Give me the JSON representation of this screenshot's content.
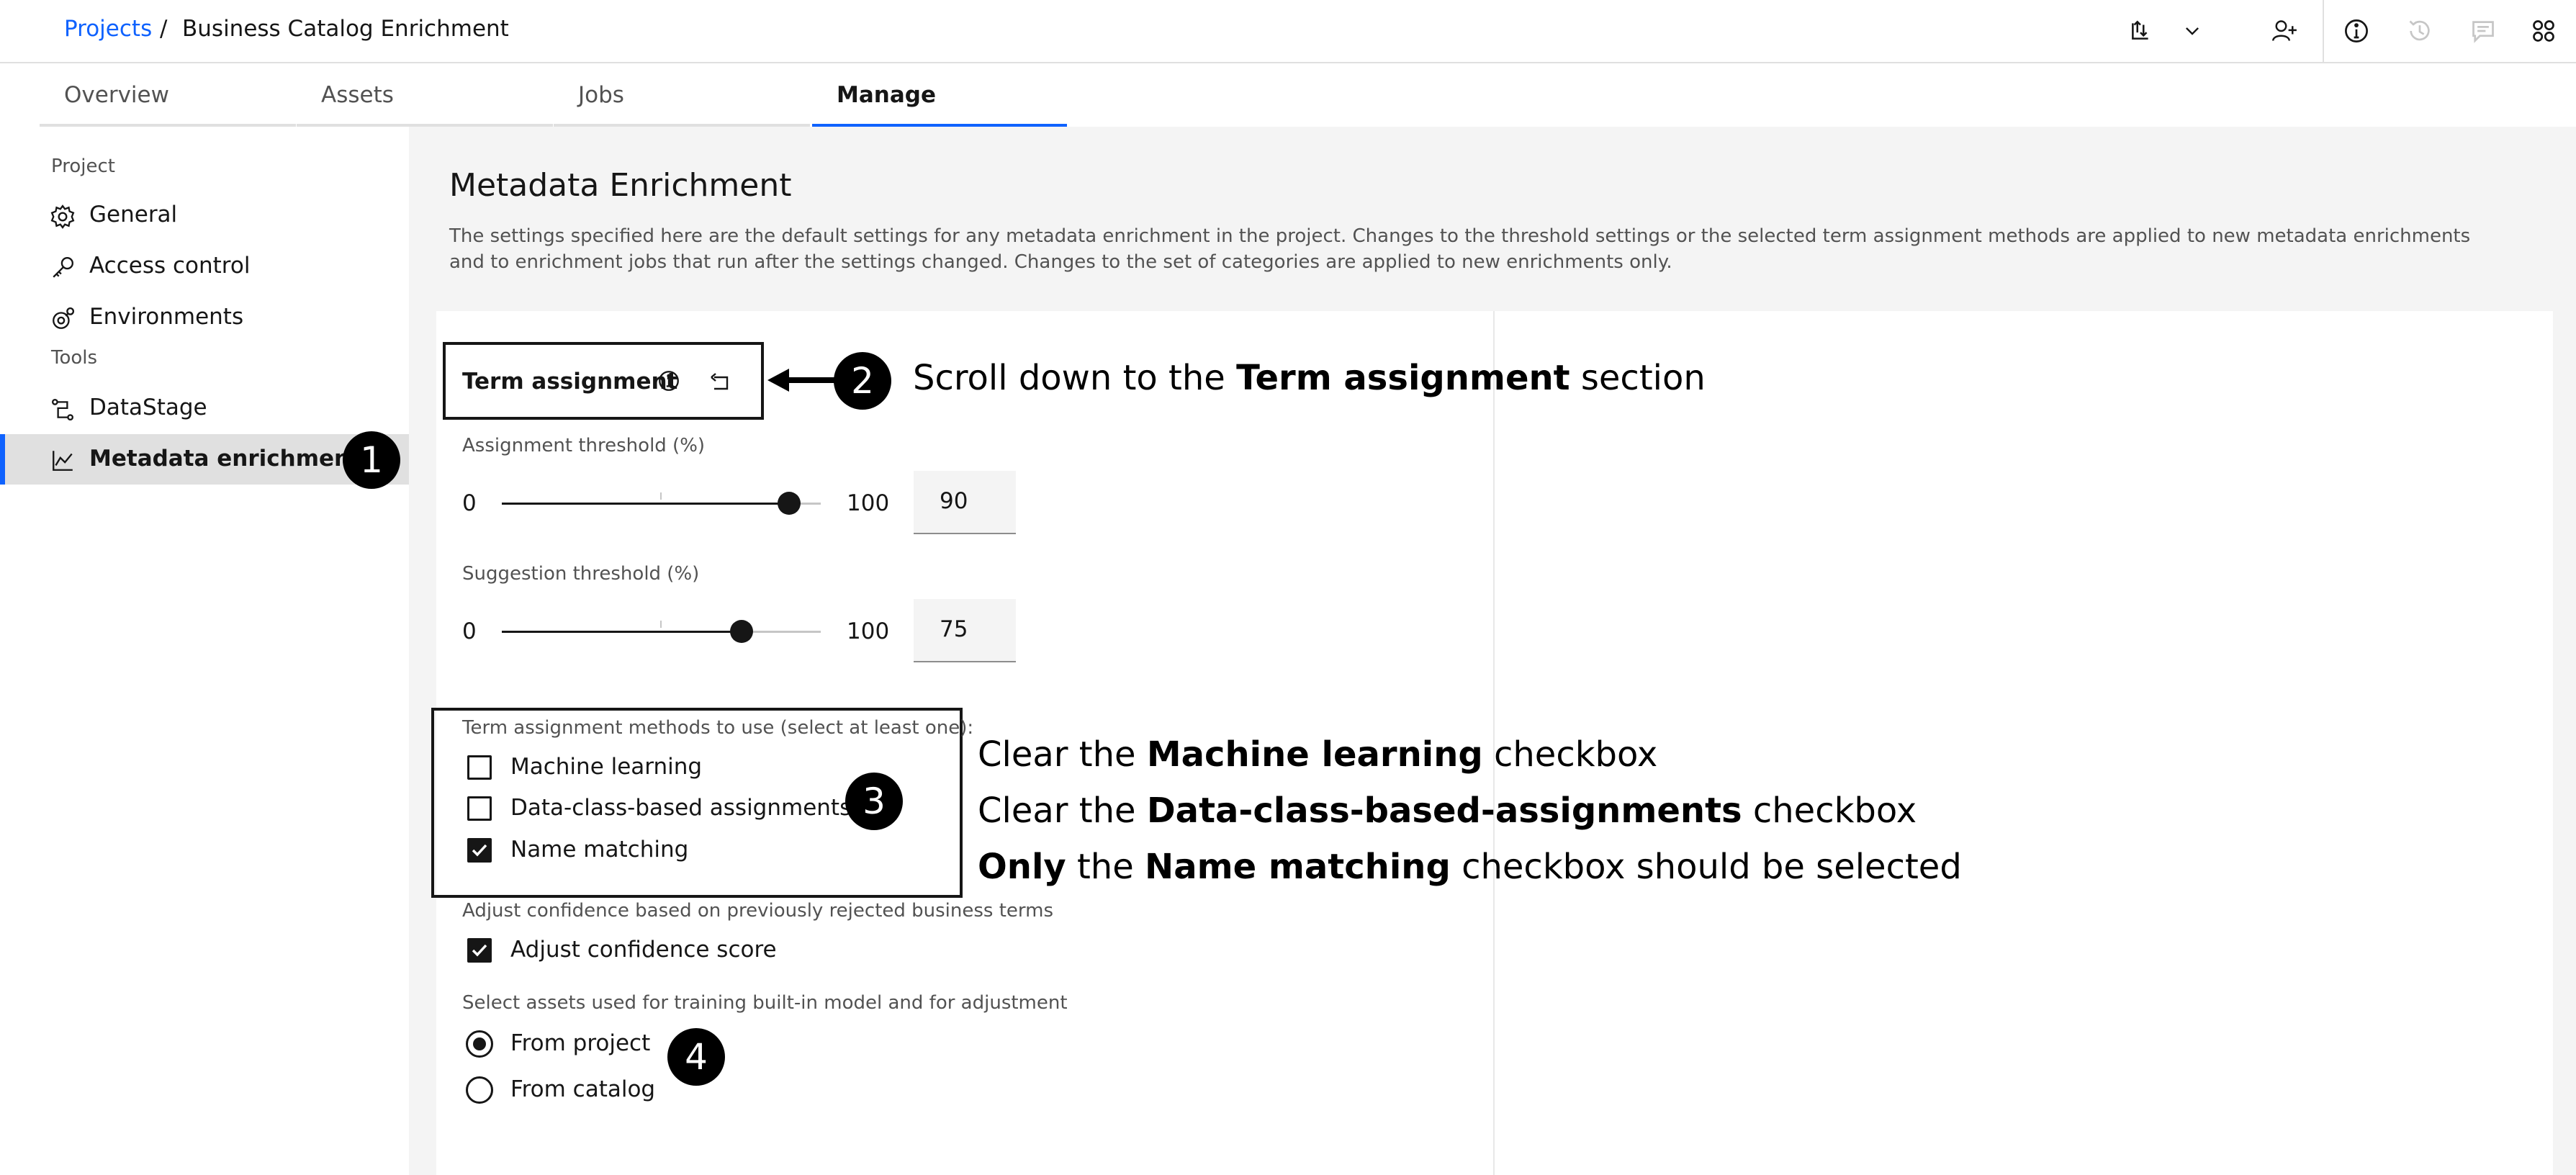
{
  "breadcrumb": {
    "projects_label": "Projects",
    "separator": "/",
    "current": "Business Catalog Enrichment"
  },
  "header_icons": [
    "upload-icon",
    "chevron-down-icon",
    "add-user-icon",
    "info-icon",
    "history-icon",
    "comment-icon",
    "apps-icon"
  ],
  "tabs": [
    {
      "label": "Overview",
      "active": false
    },
    {
      "label": "Assets",
      "active": false
    },
    {
      "label": "Jobs",
      "active": false
    },
    {
      "label": "Manage",
      "active": true
    }
  ],
  "sidebar": {
    "project_section": "Project",
    "tools_section": "Tools",
    "items": [
      {
        "label": "General",
        "icon": "gear-icon"
      },
      {
        "label": "Access control",
        "icon": "key-icon"
      },
      {
        "label": "Environments",
        "icon": "environment-icon"
      },
      {
        "label": "DataStage",
        "icon": "datastage-icon"
      },
      {
        "label": "Metadata enrichment",
        "icon": "chart-line-icon",
        "active": true
      }
    ]
  },
  "main": {
    "title": "Metadata Enrichment",
    "description": "The settings specified here are the default settings for any metadata enrichment in the project. Changes to the threshold settings or the selected term assignment methods are applied to new metadata enrichments and to enrichment jobs that run after the settings changed. Changes to the set of categories are applied to new enrichments only.",
    "term_assignment": {
      "title": "Term assignment",
      "assignment_threshold": {
        "label": "Assignment threshold (%)",
        "min": "0",
        "max": "100",
        "value": "90"
      },
      "suggestion_threshold": {
        "label": "Suggestion threshold (%)",
        "min": "0",
        "max": "100",
        "value": "75"
      },
      "methods": {
        "label": "Term assignment methods to use (select at least one):",
        "options": [
          {
            "label": "Machine learning",
            "checked": false
          },
          {
            "label": "Data-class-based assignments",
            "checked": false
          },
          {
            "label": "Name matching",
            "checked": true
          }
        ]
      },
      "adjust": {
        "label": "Adjust confidence based on previously rejected business terms",
        "option": "Adjust confidence score",
        "checked": true
      },
      "training": {
        "label": "Select assets used for training built-in model and for adjustment",
        "options": [
          {
            "label": "From project",
            "selected": true
          },
          {
            "label": "From catalog",
            "selected": false
          }
        ]
      }
    }
  },
  "annotations": {
    "badges": [
      "1",
      "2",
      "3",
      "4"
    ],
    "step2": {
      "pre": "Scroll down to the ",
      "bold": "Term assignment",
      "post": " section"
    },
    "step3a": {
      "pre": "Clear the ",
      "bold": "Machine learning",
      "post": " checkbox"
    },
    "step3b": {
      "pre": "Clear the ",
      "bold": "Data-class-based-assignments",
      "post": " checkbox"
    },
    "step3c": {
      "bold1": "Only",
      "mid": " the ",
      "bold2": "Name matching",
      "post": " checkbox should be selected"
    }
  }
}
